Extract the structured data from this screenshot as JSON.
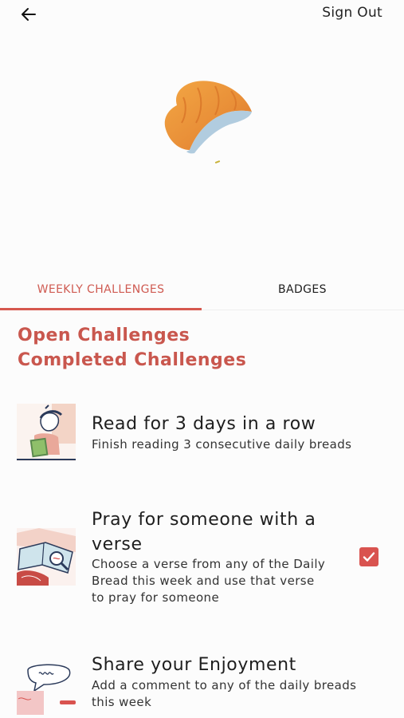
{
  "header": {
    "back_icon": "arrow-left-icon",
    "signout_label": "Sign Out"
  },
  "hero": {
    "icon": "croissant-watercolor-illustration"
  },
  "tabs": [
    {
      "label": "WEEKLY CHALLENGES",
      "active": true
    },
    {
      "label": "BADGES",
      "active": false
    }
  ],
  "sections": {
    "open_label": "Open Challenges",
    "completed_label": "Completed Challenges"
  },
  "challenges": [
    {
      "title": "Read for 3 days in a row",
      "description": "Finish reading 3 consecutive daily breads",
      "icon": "person-reading-illustration",
      "completed": false
    },
    {
      "title_line1": "Pray for someone with a",
      "title_line2": "verse",
      "description_line1": "Choose a verse from any of the Daily",
      "description_line2": "Bread this week and use that verse",
      "description_line3": "to pray for someone",
      "icon": "open-book-magnifier-illustration",
      "completed": true
    },
    {
      "title": "Share your Enjoyment",
      "description_line1": "Add a comment to any of the daily breads",
      "description_line2": "this week",
      "icon": "speech-bubble-illustration",
      "completed": false
    }
  ],
  "colors": {
    "accent": "#d6584f",
    "section_text": "#c9574e",
    "background": "#fcfcfc"
  }
}
